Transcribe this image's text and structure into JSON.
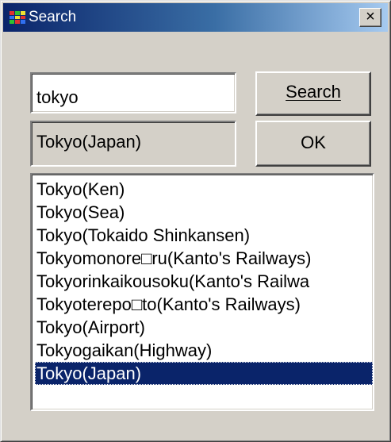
{
  "window": {
    "title": "Search",
    "close_label": "×"
  },
  "search": {
    "value": "tokyo",
    "button_label": "Search"
  },
  "result": {
    "value": "Tokyo(Japan)",
    "ok_label": "OK"
  },
  "list": {
    "items": [
      "Tokyo(Ken)",
      "Tokyo(Sea)",
      "Tokyo(Tokaido Shinkansen)",
      "Tokyomonore□ru(Kanto's Railways)",
      "Tokyorinkaikousoku(Kanto's Railwa",
      "Tokyoterepo□to(Kanto's Railways)",
      "Tokyo(Airport)",
      "Tokyogaikan(Highway)",
      "Tokyo(Japan)"
    ],
    "selected_index": 8
  },
  "colors": {
    "face": "#d4d0c8",
    "title_start": "#0a246a",
    "title_end": "#a6caf0",
    "selection": "#0a246a"
  },
  "icons": {
    "app": "app-icon",
    "close": "close-icon"
  }
}
